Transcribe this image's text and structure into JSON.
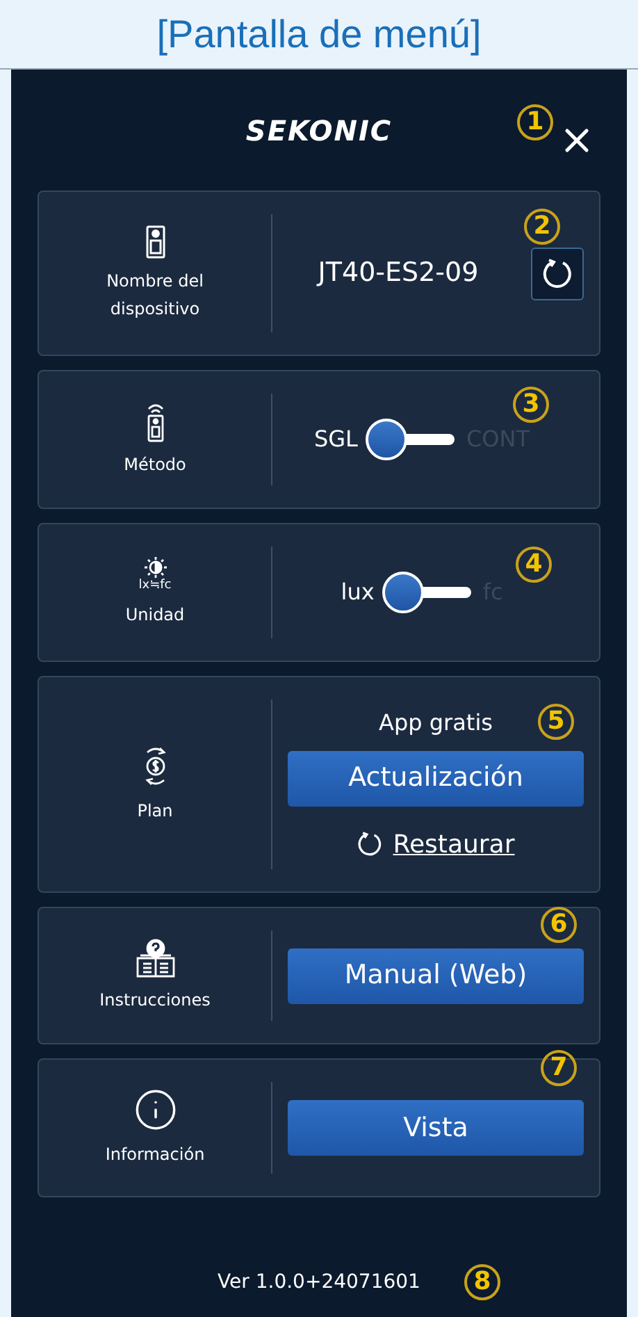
{
  "header": {
    "title": "[Pantalla de menú]"
  },
  "top_bar": {
    "logo": "SEKONIC"
  },
  "sections": [
    {
      "kind": "device",
      "label": "Nombre del dispositivo",
      "value": "JT40-ES2-09"
    },
    {
      "kind": "toggle",
      "label": "Método",
      "options": [
        {
          "label": "SGL",
          "selected": true
        },
        {
          "label": "CONT",
          "selected": false
        }
      ]
    },
    {
      "kind": "toggle",
      "label": "Unidad",
      "icon_caption": "lx≒fc",
      "options": [
        {
          "label": "lux",
          "selected": true
        },
        {
          "label": "fc",
          "selected": false
        }
      ]
    },
    {
      "kind": "plan",
      "label": "Plan",
      "status": "App gratis",
      "button": "Actualización",
      "link": "Restaurar"
    },
    {
      "kind": "button",
      "label": "Instrucciones",
      "button": "Manual (Web)"
    },
    {
      "kind": "button",
      "label": "Información",
      "button": "Vista"
    }
  ],
  "version": "Ver 1.0.0+24071601",
  "callouts": [
    "1",
    "2",
    "3",
    "4",
    "5",
    "6",
    "7",
    "8"
  ]
}
